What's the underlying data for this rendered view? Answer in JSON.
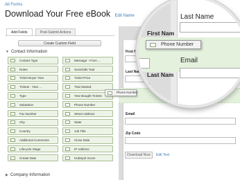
{
  "breadcrumb": "All Forms",
  "page_title": "Download Your Free eBook",
  "edit_name": "Edit Name",
  "tabs": [
    "Add Fields",
    "Post-Submit Actions"
  ],
  "create_custom_field": "Create Custom Field",
  "sections": {
    "contact": "Contact Information",
    "company": "Company Information"
  },
  "fields": [
    "Contact Type",
    "Message - From ...",
    "Notes",
    "Sonicbids Year",
    "Ticket Buyer Year",
    "Ticket Price",
    "Tickets - Year ...",
    "Trial Started",
    "Type",
    "Year Bought Tickets",
    "Salutation",
    "Phone Number",
    "Fax Number",
    "Street Address",
    "City",
    "State",
    "Country",
    "Job Title",
    "Additional Comments",
    "Close Date",
    "Lifecycle Stage",
    "IP Address",
    "Create Date",
    "HubSpot Score"
  ],
  "dragging_field": "Phone Number",
  "form": {
    "first_name": "First Name",
    "last_name": "Last Name",
    "email": "Email",
    "zip_code": "Zip Code",
    "submit": "Download Now",
    "edit_text": "Edit Text"
  },
  "magnifier": {
    "last_name": "Last Name",
    "first_name": "First Nam",
    "last_name_2": "Last Nam",
    "phone_number": "Phone Number",
    "email": "Email"
  }
}
